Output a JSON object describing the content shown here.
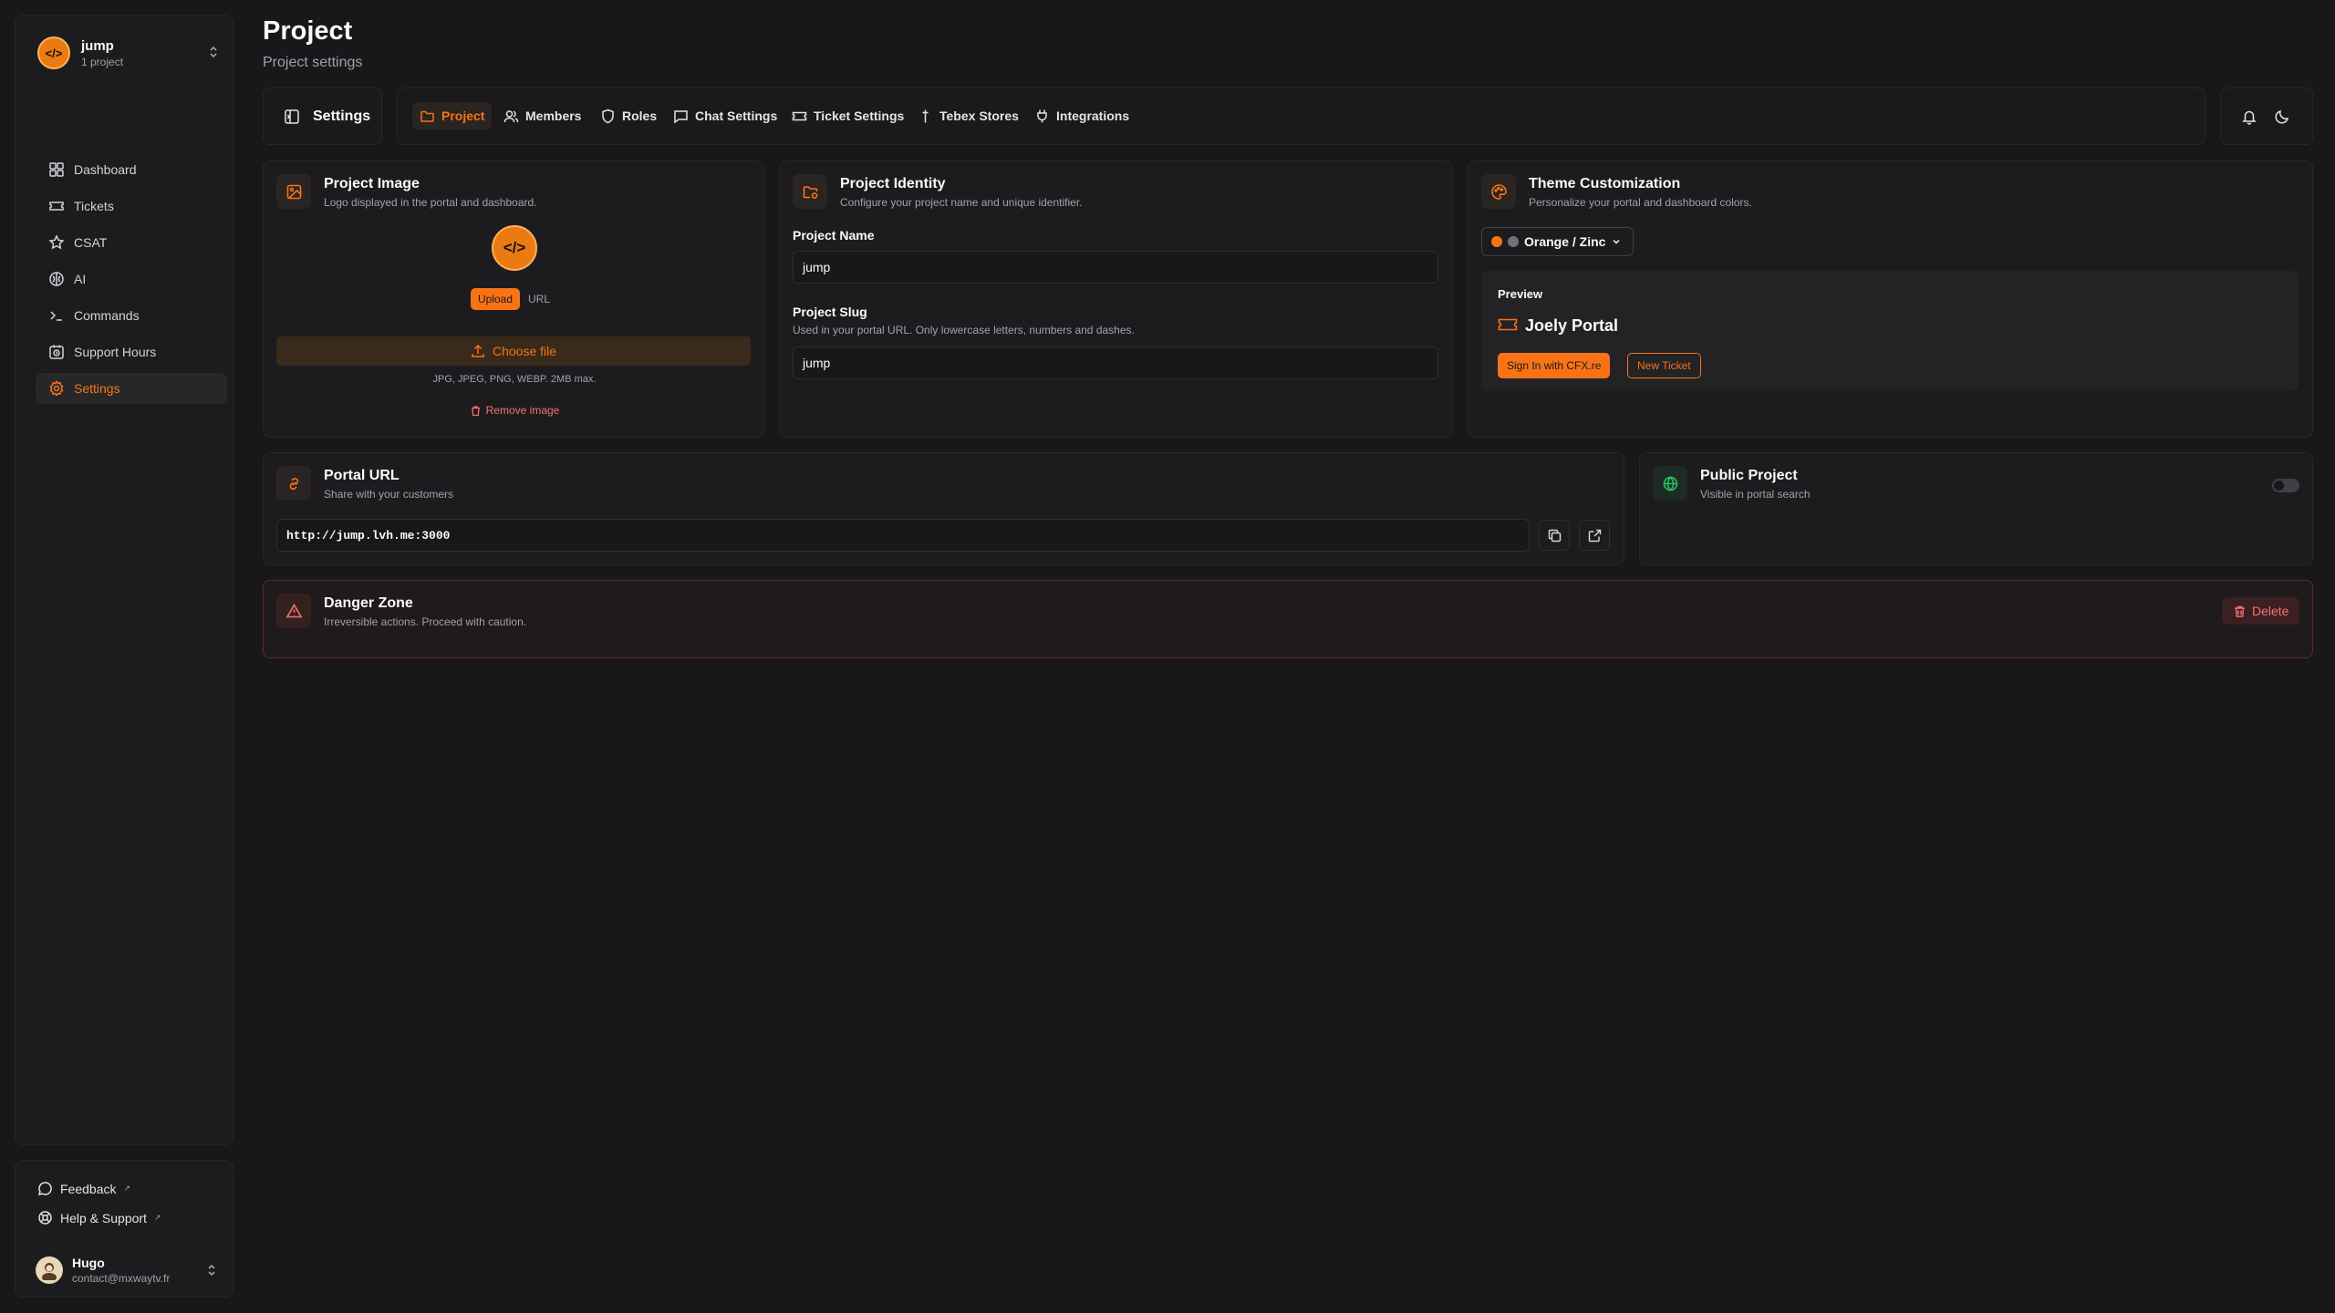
{
  "project_switcher": {
    "name": "jump",
    "subtitle": "1 project",
    "logo_text": "</>"
  },
  "nav": [
    {
      "label": "Dashboard",
      "icon": "dashboard-icon"
    },
    {
      "label": "Tickets",
      "icon": "ticket-icon"
    },
    {
      "label": "CSAT",
      "icon": "star-icon"
    },
    {
      "label": "AI",
      "icon": "ai-icon"
    },
    {
      "label": "Commands",
      "icon": "terminal-icon"
    },
    {
      "label": "Support Hours",
      "icon": "clock-icon"
    },
    {
      "label": "Settings",
      "icon": "gear-icon",
      "active": true
    }
  ],
  "footer": {
    "feedback": "Feedback",
    "help": "Help & Support",
    "user_name": "Hugo",
    "user_email": "contact@mxwaytv.fr"
  },
  "page": {
    "title": "Project",
    "subtitle": "Project settings"
  },
  "settings_label": "Settings",
  "tabs": [
    {
      "label": "Project",
      "icon": "folder-icon",
      "active": true
    },
    {
      "label": "Members",
      "icon": "users-icon"
    },
    {
      "label": "Roles",
      "icon": "shield-icon"
    },
    {
      "label": "Chat Settings",
      "icon": "chat-icon"
    },
    {
      "label": "Ticket Settings",
      "icon": "ticket-icon"
    },
    {
      "label": "Tebex Stores",
      "icon": "store-icon"
    },
    {
      "label": "Integrations",
      "icon": "plug-icon"
    }
  ],
  "project_image": {
    "title": "Project Image",
    "desc": "Logo displayed in the portal and dashboard.",
    "toggle_upload": "Upload",
    "toggle_url": "URL",
    "choose_file": "Choose file",
    "formats": "JPG, JPEG, PNG, WEBP. 2MB max.",
    "remove": "Remove image"
  },
  "project_identity": {
    "title": "Project Identity",
    "desc": "Configure your project name and unique identifier.",
    "name_label": "Project Name",
    "name_value": "jump",
    "slug_label": "Project Slug",
    "slug_hint": "Used in your portal URL. Only lowercase letters, numbers and dashes.",
    "slug_value": "jump"
  },
  "theme": {
    "title": "Theme Customization",
    "desc": "Personalize your portal and dashboard colors.",
    "selected": "Orange / Zinc",
    "accent": "#f97316",
    "base": "#71717a",
    "preview_label": "Preview",
    "preview_title": "Joely Portal",
    "signin_button": "Sign In with CFX.re",
    "new_ticket_button": "New Ticket"
  },
  "portal_url": {
    "title": "Portal URL",
    "desc": "Share with your customers",
    "value": "http://jump.lvh.me:3000"
  },
  "public_project": {
    "title": "Public Project",
    "desc": "Visible in portal search",
    "enabled": false
  },
  "danger": {
    "title": "Danger Zone",
    "desc": "Irreversible actions. Proceed with caution.",
    "delete": "Delete"
  }
}
